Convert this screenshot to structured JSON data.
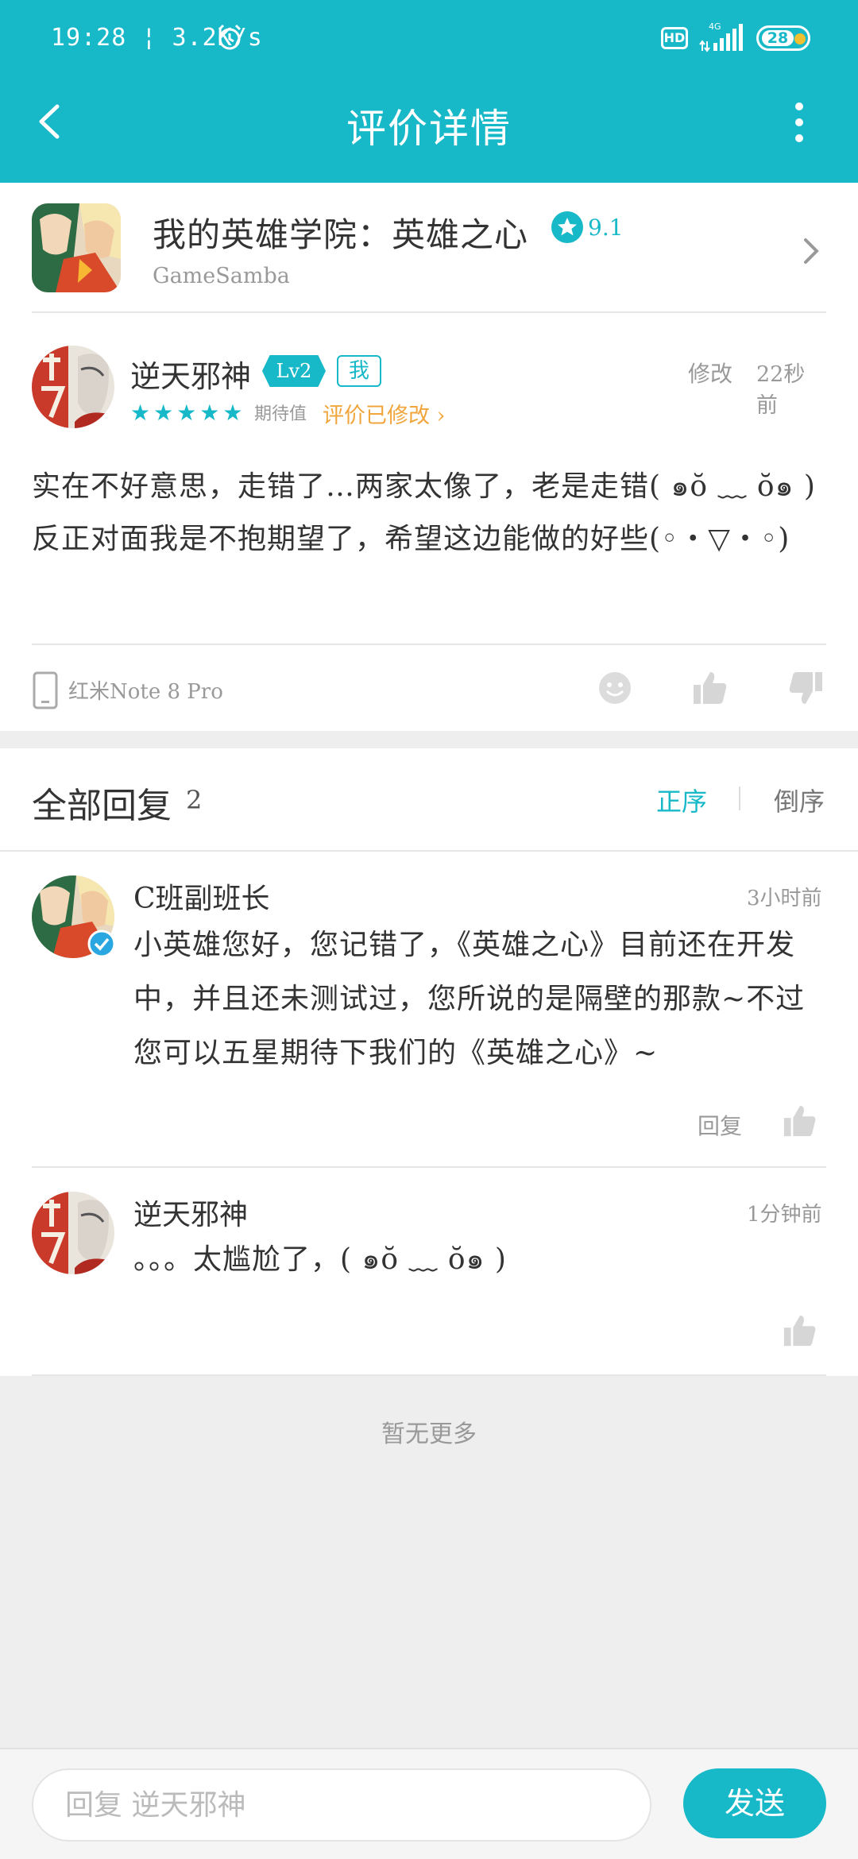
{
  "status_bar": {
    "time": "19:28",
    "speed": "3.2K/s",
    "hd": "HD",
    "network": "4G",
    "battery": "28"
  },
  "nav": {
    "title": "评价详情"
  },
  "game": {
    "name": "我的英雄学院：英雄之心",
    "score": "9.1",
    "developer": "GameSamba"
  },
  "review": {
    "author": "逆天邪神",
    "level": "Lv2",
    "me_tag": "我",
    "stars": "★★★★★",
    "expect_label": "期待值",
    "modified_label": "评价已修改",
    "edit_label": "修改",
    "time": "22秒前",
    "body": "实在不好意思，走错了…两家太像了，老是走错( ๑ŏ ﹏ ŏ๑ )反正对面我是不抱期望了，希望这边能做的好些(◦・▽・◦)",
    "device": "红米Note 8 Pro"
  },
  "replies": {
    "title": "全部回复",
    "count": "2",
    "sort_forward": "正序",
    "sort_reverse": "倒序",
    "items": [
      {
        "author": "C班副班长",
        "time": "3小时前",
        "body": "小英雄您好，您记错了，《英雄之心》目前还在开发中，并且还未测试过，您所说的是隔壁的那款~不过您可以五星期待下我们的《英雄之心》~",
        "reply_label": "回复"
      },
      {
        "author": "逆天邪神",
        "time": "1分钟前",
        "body": "。。。太尴尬了，( ๑ŏ ﹏ ŏ๑ )"
      }
    ],
    "no_more": "暂无更多"
  },
  "composer": {
    "placeholder": "回复 逆天邪神",
    "send_label": "发送"
  },
  "colors": {
    "accent": "#17b8c8",
    "warning": "#f0a63c"
  }
}
